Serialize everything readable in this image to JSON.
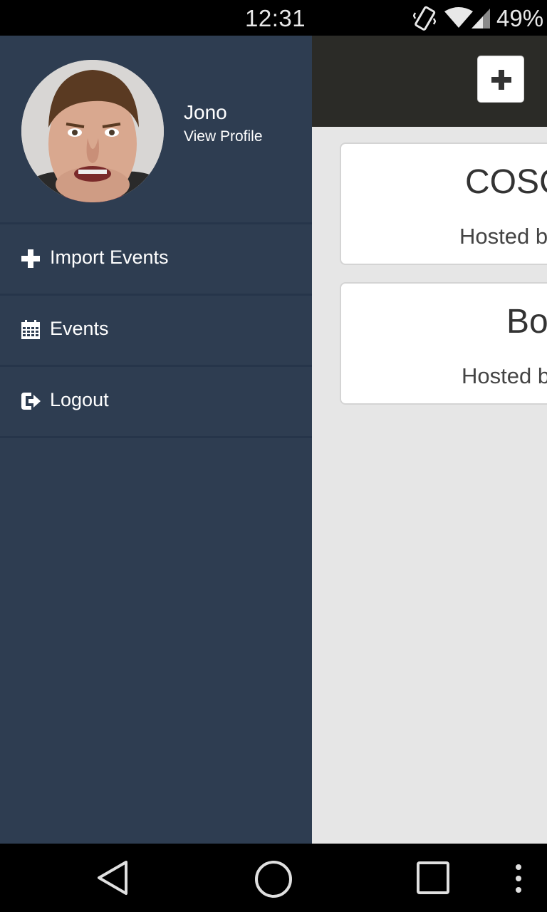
{
  "status_bar": {
    "time": "12:31",
    "battery": "49%",
    "icons": [
      "vibrate-icon",
      "wifi-icon",
      "cell-signal-icon"
    ]
  },
  "header": {
    "add_button_icon": "plus-icon"
  },
  "events": [
    {
      "title": "COSC",
      "host": "Hosted by"
    },
    {
      "title": "Bo",
      "host": "Hosted b"
    }
  ],
  "drawer": {
    "profile": {
      "name": "Jono",
      "link": "View Profile"
    },
    "menu": [
      {
        "label": "Import Events",
        "icon": "plus-icon"
      },
      {
        "label": "Events",
        "icon": "calendar-icon"
      },
      {
        "label": "Logout",
        "icon": "logout-icon"
      }
    ]
  },
  "nav_bar": {
    "icons": [
      "back-icon",
      "home-icon",
      "recents-icon",
      "more-icon"
    ]
  },
  "colors": {
    "drawer_bg": "#2e3d51",
    "drawer_divider": "#26354a",
    "header_bg": "#2b2b27",
    "content_bg": "#e6e6e6",
    "card_bg": "#ffffff"
  }
}
